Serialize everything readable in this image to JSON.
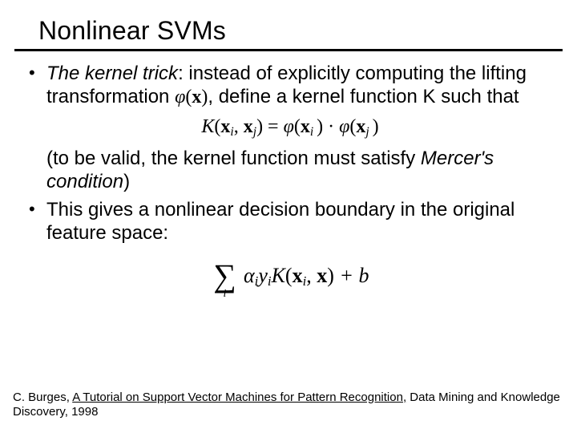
{
  "title": "Nonlinear SVMs",
  "b1_intro_italic": "The kernel trick",
  "b1_rest_a": ": instead of explicitly computing the lifting transformation ",
  "b1_phi": "φ",
  "b1_x": "(x)",
  "b1_rest_b": ", define a kernel function K such that",
  "eq_K": "K",
  "eq_open": "(",
  "eq_xi_x": "x",
  "eq_xi_i": "i",
  "eq_comma": ", ",
  "eq_xj_x": "x",
  "eq_xj_j": "j",
  "eq_close_eq": ") = ",
  "eq_phi1_phi": "φ",
  "eq_phi1_open": "(",
  "eq_phi1_x": "x",
  "eq_phi1_i": "i ",
  "eq_phi1_close": ")",
  "eq_dot": " · ",
  "eq_phi2_phi": "φ",
  "eq_phi2_open": "(",
  "eq_phi2_x": "x",
  "eq_phi2_j": "j ",
  "eq_phi2_close": ")",
  "valid_a": "(to be valid, the kernel function must satisfy ",
  "valid_b_italic": "Mercer's condition",
  "valid_c": ")",
  "b2": "This gives a nonlinear decision boundary in the original feature space:",
  "sigma": "∑",
  "sigma_sub": "i",
  "dec_alpha": "α",
  "dec_i1": "i",
  "dec_y": "y",
  "dec_i2": "i",
  "dec_K": "K",
  "dec_open": "(",
  "dec_xi_x": "x",
  "dec_xi_i": "i",
  "dec_comma": ", ",
  "dec_x2": "x",
  "dec_close": ")",
  "dec_plus_b": " + b",
  "cite_a": "C. Burges, ",
  "cite_link": "A Tutorial on Support Vector Machines for Pattern Recognition,",
  "cite_b": "  Data Mining and Knowledge Discovery, 1998"
}
